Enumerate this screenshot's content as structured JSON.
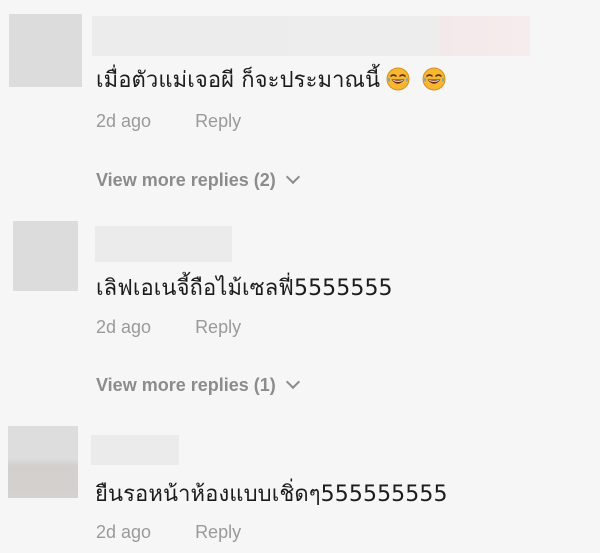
{
  "comments": [
    {
      "text": "เมื่อตัวแม่เจอผี ก็จะประมาณนี้",
      "emojis": [
        "tears-of-joy-emoji",
        "tears-of-joy-emoji"
      ],
      "time": "2d ago",
      "reply_label": "Reply",
      "view_more": "View more replies (2)"
    },
    {
      "text": "เลิฟเอเนจี้ถือไม้เซลฟี่5555555",
      "time": "2d ago",
      "reply_label": "Reply",
      "view_more": "View more replies (1)"
    },
    {
      "text": "ยืนรอหน้าห้องแบบเชิ่ดๆ555555555",
      "time": "2d ago",
      "reply_label": "Reply"
    }
  ],
  "colors": {
    "background": "#f6f6f6",
    "avatar_placeholder": "#dcdcdc",
    "muted_text": "#9a9a9a",
    "emoji_face": "#f7b733"
  }
}
